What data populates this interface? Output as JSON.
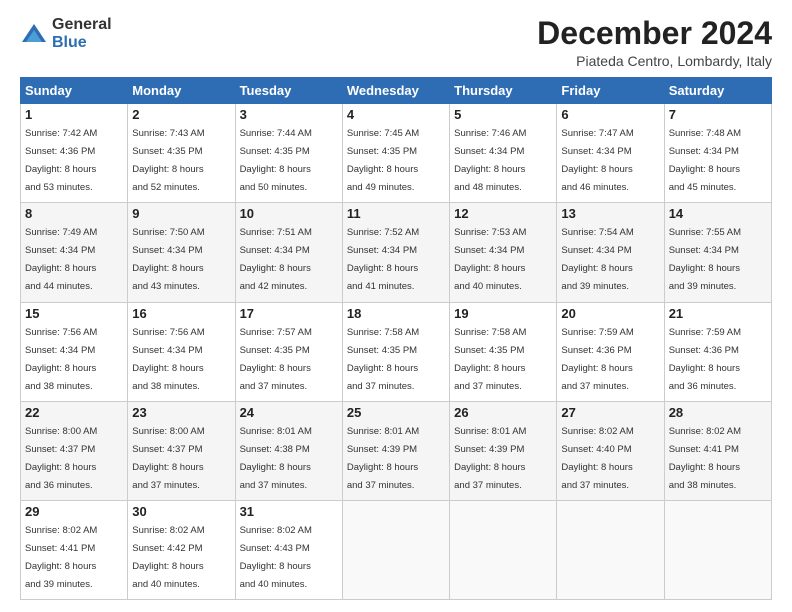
{
  "logo": {
    "general": "General",
    "blue": "Blue"
  },
  "title": "December 2024",
  "location": "Piateda Centro, Lombardy, Italy",
  "days_of_week": [
    "Sunday",
    "Monday",
    "Tuesday",
    "Wednesday",
    "Thursday",
    "Friday",
    "Saturday"
  ],
  "weeks": [
    [
      {
        "day": "1",
        "sunrise": "7:42 AM",
        "sunset": "4:36 PM",
        "daylight": "8 hours and 53 minutes."
      },
      {
        "day": "2",
        "sunrise": "7:43 AM",
        "sunset": "4:35 PM",
        "daylight": "8 hours and 52 minutes."
      },
      {
        "day": "3",
        "sunrise": "7:44 AM",
        "sunset": "4:35 PM",
        "daylight": "8 hours and 50 minutes."
      },
      {
        "day": "4",
        "sunrise": "7:45 AM",
        "sunset": "4:35 PM",
        "daylight": "8 hours and 49 minutes."
      },
      {
        "day": "5",
        "sunrise": "7:46 AM",
        "sunset": "4:34 PM",
        "daylight": "8 hours and 48 minutes."
      },
      {
        "day": "6",
        "sunrise": "7:47 AM",
        "sunset": "4:34 PM",
        "daylight": "8 hours and 46 minutes."
      },
      {
        "day": "7",
        "sunrise": "7:48 AM",
        "sunset": "4:34 PM",
        "daylight": "8 hours and 45 minutes."
      }
    ],
    [
      {
        "day": "8",
        "sunrise": "7:49 AM",
        "sunset": "4:34 PM",
        "daylight": "8 hours and 44 minutes."
      },
      {
        "day": "9",
        "sunrise": "7:50 AM",
        "sunset": "4:34 PM",
        "daylight": "8 hours and 43 minutes."
      },
      {
        "day": "10",
        "sunrise": "7:51 AM",
        "sunset": "4:34 PM",
        "daylight": "8 hours and 42 minutes."
      },
      {
        "day": "11",
        "sunrise": "7:52 AM",
        "sunset": "4:34 PM",
        "daylight": "8 hours and 41 minutes."
      },
      {
        "day": "12",
        "sunrise": "7:53 AM",
        "sunset": "4:34 PM",
        "daylight": "8 hours and 40 minutes."
      },
      {
        "day": "13",
        "sunrise": "7:54 AM",
        "sunset": "4:34 PM",
        "daylight": "8 hours and 39 minutes."
      },
      {
        "day": "14",
        "sunrise": "7:55 AM",
        "sunset": "4:34 PM",
        "daylight": "8 hours and 39 minutes."
      }
    ],
    [
      {
        "day": "15",
        "sunrise": "7:56 AM",
        "sunset": "4:34 PM",
        "daylight": "8 hours and 38 minutes."
      },
      {
        "day": "16",
        "sunrise": "7:56 AM",
        "sunset": "4:34 PM",
        "daylight": "8 hours and 38 minutes."
      },
      {
        "day": "17",
        "sunrise": "7:57 AM",
        "sunset": "4:35 PM",
        "daylight": "8 hours and 37 minutes."
      },
      {
        "day": "18",
        "sunrise": "7:58 AM",
        "sunset": "4:35 PM",
        "daylight": "8 hours and 37 minutes."
      },
      {
        "day": "19",
        "sunrise": "7:58 AM",
        "sunset": "4:35 PM",
        "daylight": "8 hours and 37 minutes."
      },
      {
        "day": "20",
        "sunrise": "7:59 AM",
        "sunset": "4:36 PM",
        "daylight": "8 hours and 37 minutes."
      },
      {
        "day": "21",
        "sunrise": "7:59 AM",
        "sunset": "4:36 PM",
        "daylight": "8 hours and 36 minutes."
      }
    ],
    [
      {
        "day": "22",
        "sunrise": "8:00 AM",
        "sunset": "4:37 PM",
        "daylight": "8 hours and 36 minutes."
      },
      {
        "day": "23",
        "sunrise": "8:00 AM",
        "sunset": "4:37 PM",
        "daylight": "8 hours and 37 minutes."
      },
      {
        "day": "24",
        "sunrise": "8:01 AM",
        "sunset": "4:38 PM",
        "daylight": "8 hours and 37 minutes."
      },
      {
        "day": "25",
        "sunrise": "8:01 AM",
        "sunset": "4:39 PM",
        "daylight": "8 hours and 37 minutes."
      },
      {
        "day": "26",
        "sunrise": "8:01 AM",
        "sunset": "4:39 PM",
        "daylight": "8 hours and 37 minutes."
      },
      {
        "day": "27",
        "sunrise": "8:02 AM",
        "sunset": "4:40 PM",
        "daylight": "8 hours and 37 minutes."
      },
      {
        "day": "28",
        "sunrise": "8:02 AM",
        "sunset": "4:41 PM",
        "daylight": "8 hours and 38 minutes."
      }
    ],
    [
      {
        "day": "29",
        "sunrise": "8:02 AM",
        "sunset": "4:41 PM",
        "daylight": "8 hours and 39 minutes."
      },
      {
        "day": "30",
        "sunrise": "8:02 AM",
        "sunset": "4:42 PM",
        "daylight": "8 hours and 40 minutes."
      },
      {
        "day": "31",
        "sunrise": "8:02 AM",
        "sunset": "4:43 PM",
        "daylight": "8 hours and 40 minutes."
      },
      null,
      null,
      null,
      null
    ]
  ],
  "labels": {
    "sunrise": "Sunrise:",
    "sunset": "Sunset:",
    "daylight": "Daylight:"
  }
}
